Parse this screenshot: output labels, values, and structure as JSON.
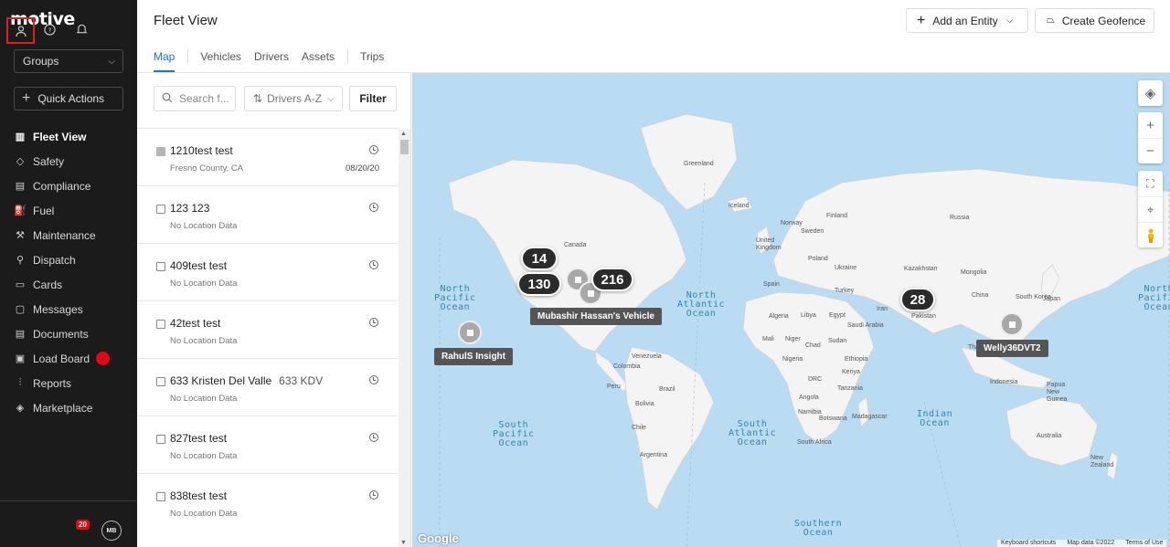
{
  "sidebar": {
    "logo": "motive",
    "groups_label": "Groups",
    "quick_actions_label": "Quick Actions",
    "nav": [
      {
        "label": "Fleet View",
        "icon": "map-icon",
        "active": true
      },
      {
        "label": "Safety",
        "icon": "shield-icon"
      },
      {
        "label": "Compliance",
        "icon": "document-icon"
      },
      {
        "label": "Fuel",
        "icon": "fuel-icon"
      },
      {
        "label": "Maintenance",
        "icon": "wrench-icon"
      },
      {
        "label": "Dispatch",
        "icon": "location-pin-icon"
      },
      {
        "label": "Cards",
        "icon": "card-icon"
      },
      {
        "label": "Messages",
        "icon": "chat-icon"
      },
      {
        "label": "Documents",
        "icon": "file-icon"
      },
      {
        "label": "Load Board",
        "icon": "truck-icon",
        "dot": true
      },
      {
        "label": "Reports",
        "icon": "chart-icon"
      },
      {
        "label": "Marketplace",
        "icon": "layers-icon"
      }
    ],
    "notifications_count": "20",
    "avatar_initials": "MB"
  },
  "header": {
    "title": "Fleet View",
    "add_entity_label": "Add an Entity",
    "create_geofence_label": "Create Geofence",
    "tabs": [
      "Map",
      "Vehicles",
      "Drivers",
      "Assets",
      "Trips"
    ]
  },
  "list": {
    "search_placeholder": "Search f...",
    "sort_label": "Drivers A-Z",
    "filter_label": "Filter",
    "rows": [
      {
        "name": "1210test test",
        "sub": "Fresno County, CA",
        "date": "08/20/20",
        "filled": true
      },
      {
        "name": "123 123",
        "sub": "No Location Data"
      },
      {
        "name": "409test test",
        "sub": "No Location Data"
      },
      {
        "name": "42test test",
        "sub": "No Location Data"
      },
      {
        "name": "633 Kristen Del Valle",
        "extra": "633 KDV",
        "sub": "No Location Data"
      },
      {
        "name": "827test test",
        "sub": "No Location Data"
      },
      {
        "name": "838test test",
        "sub": "No Location Data"
      }
    ]
  },
  "map": {
    "oceans": {
      "north_pacific": "North\nPacific\nOcean",
      "north_atlantic": "North\nAtlantic\nOcean",
      "north_pacific_east": "North\nPacific\nOcean",
      "south_pacific": "South\nPacific\nOcean",
      "south_atlantic": "South\nAtlantic\nOcean",
      "indian": "Indian\nOcean",
      "southern": "Southern\nOcean"
    },
    "countries": [
      "Greenland",
      "Iceland",
      "Norway",
      "Sweden",
      "Finland",
      "Russia",
      "United Kingdom",
      "Poland",
      "Ukraine",
      "Kazakhstan",
      "Mongolia",
      "China",
      "South Korea",
      "Japan",
      "Turkey",
      "Iran",
      "Pakistan",
      "Spain",
      "Algeria",
      "Libya",
      "Egypt",
      "Saudi Arabia",
      "Mali",
      "Niger",
      "Chad",
      "Sudan",
      "Nigeria",
      "Ethiopia",
      "Kenya",
      "DRC",
      "Angola",
      "Tanzania",
      "Namibia",
      "Botswana",
      "Madagascar",
      "South Africa",
      "Canada",
      "Venezuela",
      "Colombia",
      "Peru",
      "Brazil",
      "Bolivia",
      "Chile",
      "Argentina",
      "Indonesia",
      "Papua New Guinea",
      "Australia",
      "New Zealand",
      "Thailand"
    ],
    "clusters": [
      {
        "label": "14"
      },
      {
        "label": "130"
      },
      {
        "label": "216"
      },
      {
        "label": "28"
      }
    ],
    "tags": {
      "mubashir": "Mubashir Hassan's Vehicle",
      "rahul": "RahulS Insight",
      "welly": "Welly36DVT2"
    },
    "google_label": "Google",
    "attribution": [
      "Keyboard shortcuts",
      "Map data ©2022",
      "Terms of Use"
    ]
  }
}
